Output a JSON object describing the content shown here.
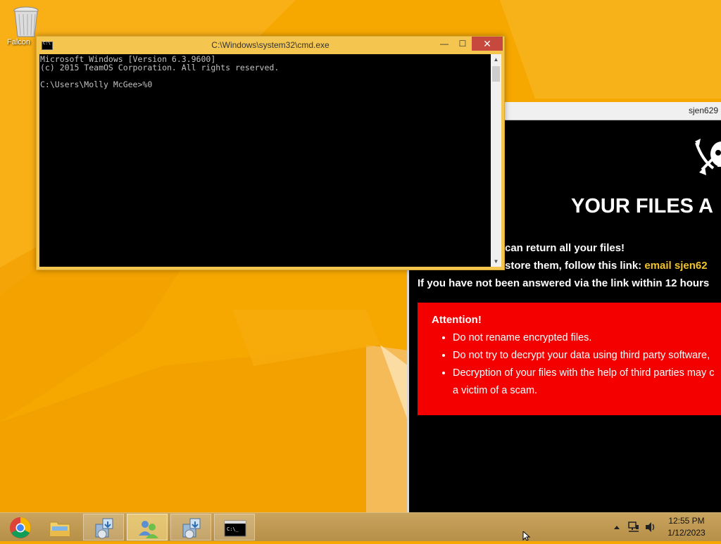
{
  "desktop": {
    "icons": [
      {
        "label": "Falcon",
        "icon": "recycle-bin-icon"
      }
    ]
  },
  "cmd_window": {
    "title": "C:\\Windows\\system32\\cmd.exe",
    "lines": [
      "Microsoft Windows [Version 6.3.9600]",
      "(c) 2015 TeamOS Corporation. All rights reserved.",
      "",
      "C:\\Users\\Molly McGee>%0"
    ],
    "controls": {
      "minimize": "—",
      "maximize": "☐",
      "close": "✕"
    }
  },
  "ransom_window": {
    "title": "sjen629",
    "headline": "YOUR FILES A",
    "line1": "can return all your files!",
    "line2_prefix": "store them, follow this link:",
    "line2_link": "email sjen62",
    "line3": "If you have not been answered via the link within 12 hours",
    "attention": {
      "title": "Attention!",
      "items": [
        "Do not rename encrypted files.",
        "Do not try to decrypt your data using third party software,",
        "Decryption of your files with the help of third parties may c",
        "a victim of a scam."
      ]
    }
  },
  "taskbar": {
    "items": [
      {
        "name": "chrome",
        "icon": "chrome-icon",
        "state": "normal"
      },
      {
        "name": "file-explorer",
        "icon": "folder-icon",
        "state": "normal"
      },
      {
        "name": "installer-1",
        "icon": "installer-icon",
        "state": "running"
      },
      {
        "name": "users",
        "icon": "users-icon",
        "state": "active"
      },
      {
        "name": "installer-2",
        "icon": "installer-icon",
        "state": "running"
      },
      {
        "name": "cmd",
        "icon": "cmd-icon",
        "state": "running"
      }
    ],
    "clock": {
      "time": "12:55 PM",
      "date": "1/12/2023"
    }
  },
  "colors": {
    "desktop_background": "#f6a800",
    "cmd_frame": "#f5c64f",
    "close_button": "#c7483c",
    "attention_box": "#f40000",
    "link_highlight": "#f3c42a"
  }
}
